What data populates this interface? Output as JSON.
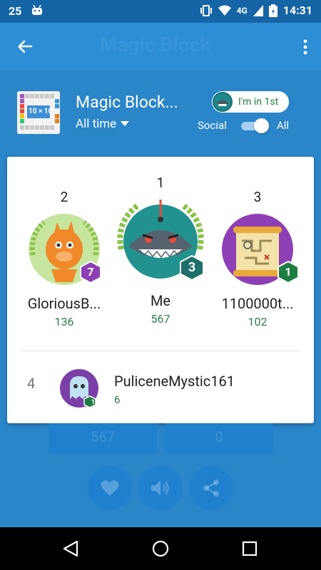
{
  "status_bar": {
    "left_number": "25",
    "network": "4G",
    "time": "14:31"
  },
  "app_bar": {
    "ghost_title": "Magic Block",
    "back_icon": "arrow-back-icon",
    "more_icon": "more-vert-icon"
  },
  "header": {
    "game_title": "Magic Block...",
    "thumbnail_text": "10 × 10",
    "timeframe": "All time",
    "rank_chip": "I'm in 1st",
    "social_label": "Social",
    "all_label": "All",
    "toggle_on": true
  },
  "podium": [
    {
      "rank": "2",
      "name": "GloriousB...",
      "score": "136",
      "level": "7",
      "badge_color": "#8e3fb5"
    },
    {
      "rank": "1",
      "name": "Me",
      "score": "567",
      "level": "3",
      "badge_color": "#1f6f6b"
    },
    {
      "rank": "3",
      "name": "1100000t...",
      "score": "102",
      "level": "1",
      "badge_color": "#1e7e42"
    }
  ],
  "list": [
    {
      "rank": "4",
      "name": "PuliceneMystic161",
      "score": "6",
      "level": "11"
    }
  ],
  "background_scores": {
    "left": "567",
    "right": "0"
  },
  "colors": {
    "primary": "#2d8ed6",
    "status_bar": "#1565a6",
    "score_green": "#2a7f46"
  }
}
